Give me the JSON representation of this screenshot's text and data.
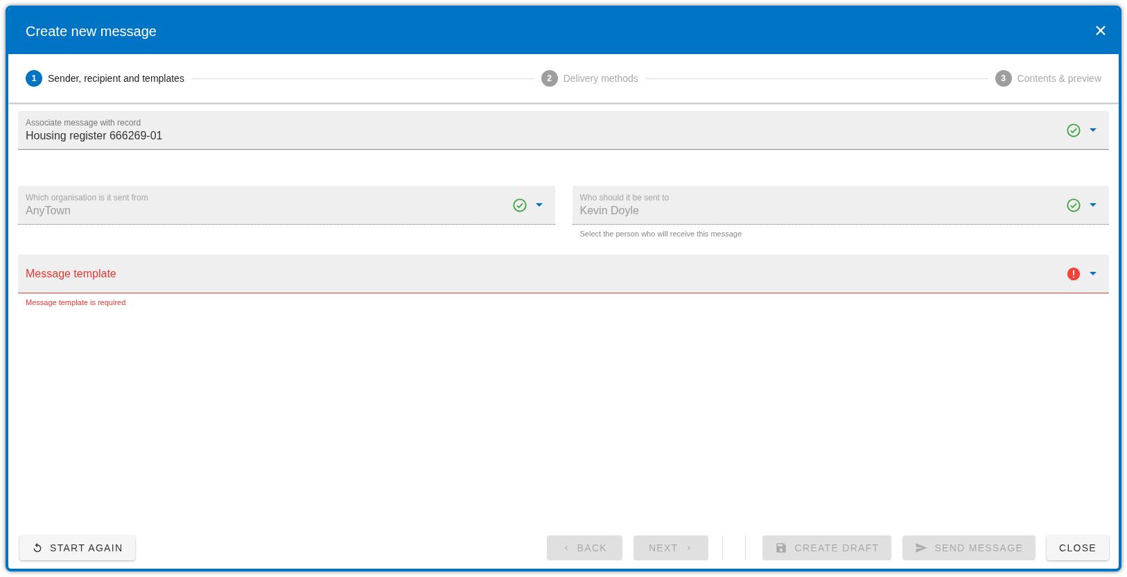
{
  "dialog": {
    "title": "Create new message"
  },
  "steps": [
    {
      "number": "1",
      "label": "Sender, recipient and templates",
      "selected": true
    },
    {
      "number": "2",
      "label": "Delivery methods",
      "selected": false
    },
    {
      "number": "3",
      "label": "Contents & preview",
      "selected": false
    }
  ],
  "fields": [
    {
      "label": "Associate message with record",
      "value": "Housing register 666269-01",
      "valid": true,
      "disabled": false
    },
    {
      "label": "Which organisation is it sent from",
      "value": "AnyTown",
      "valid": true,
      "disabled": true
    },
    {
      "label": "Who should it be sent to",
      "value": "Kevin Doyle",
      "valid": true,
      "disabled": true,
      "helper": "Select the person who will receive this message"
    },
    {
      "label": "Message template",
      "valid": false,
      "disabled": false,
      "error": "Message template is required"
    }
  ],
  "actions_left": [
    {
      "kind": "restart",
      "label": "START AGAIN",
      "disabled": false
    }
  ],
  "actions_right": [
    {
      "kind": "back",
      "label": "BACK",
      "disabled": true
    },
    {
      "kind": "next",
      "label": "NEXT",
      "disabled": true
    },
    {
      "kind": "divider"
    },
    {
      "kind": "draft",
      "label": "CREATE DRAFT",
      "disabled": true
    },
    {
      "kind": "send",
      "label": "SEND MESSAGE",
      "disabled": true
    },
    {
      "kind": "close",
      "label": "CLOSE",
      "disabled": false
    }
  ]
}
